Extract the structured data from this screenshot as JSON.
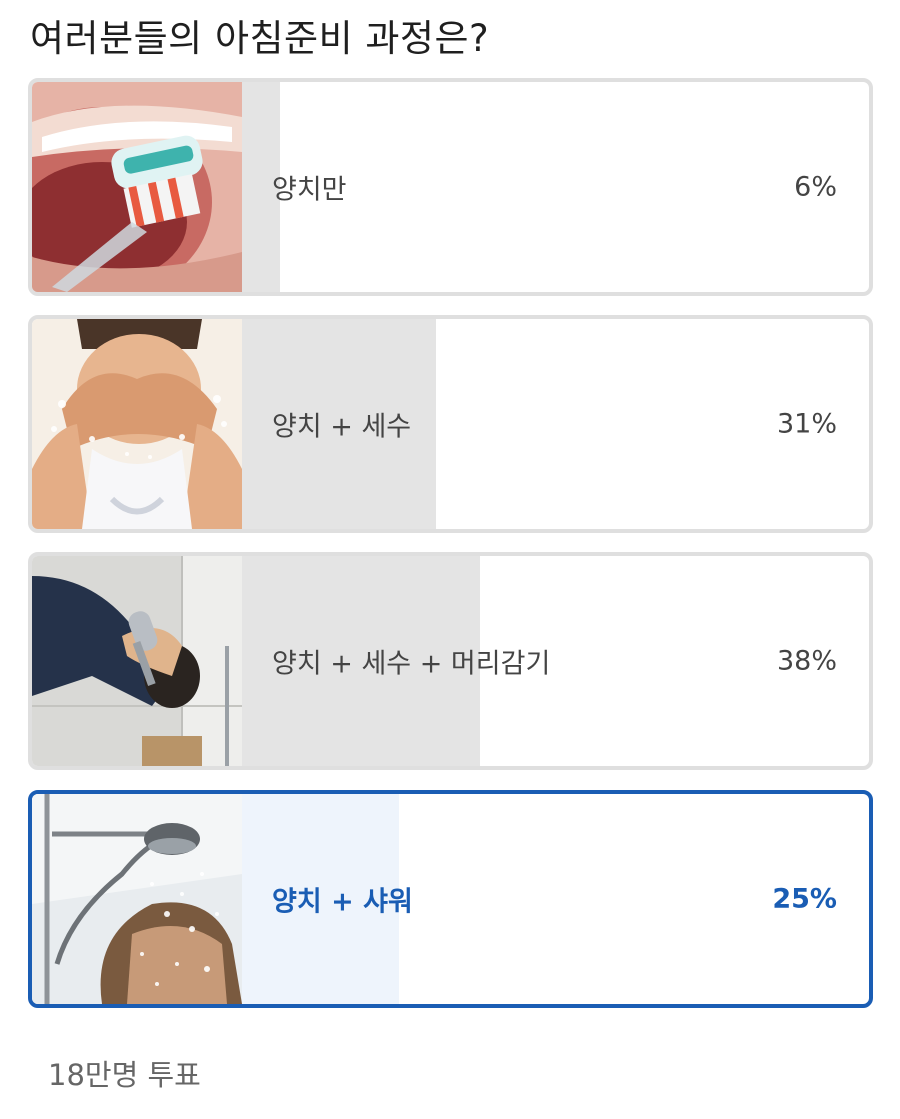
{
  "poll": {
    "question": "여러분들의 아침준비 과정은?",
    "options": [
      {
        "label": "양치만",
        "percent_text": "6%",
        "percent": 6,
        "image": "toothbrush-photo"
      },
      {
        "label": "양치 + 세수",
        "percent_text": "31%",
        "percent": 31,
        "image": "face-wash-photo"
      },
      {
        "label": "양치 + 세수 + 머리감기",
        "percent_text": "38%",
        "percent": 38,
        "image": "hair-wash-photo"
      },
      {
        "label": "양치 + 샤워",
        "percent_text": "25%",
        "percent": 25,
        "image": "shower-photo",
        "selected": true
      }
    ],
    "vote_count": "18만명 투표"
  },
  "colors": {
    "accent": "#1a5db4",
    "bar": "#e4e4e4",
    "bar_selected": "#eef4fc",
    "border": "#dfdfdf"
  }
}
